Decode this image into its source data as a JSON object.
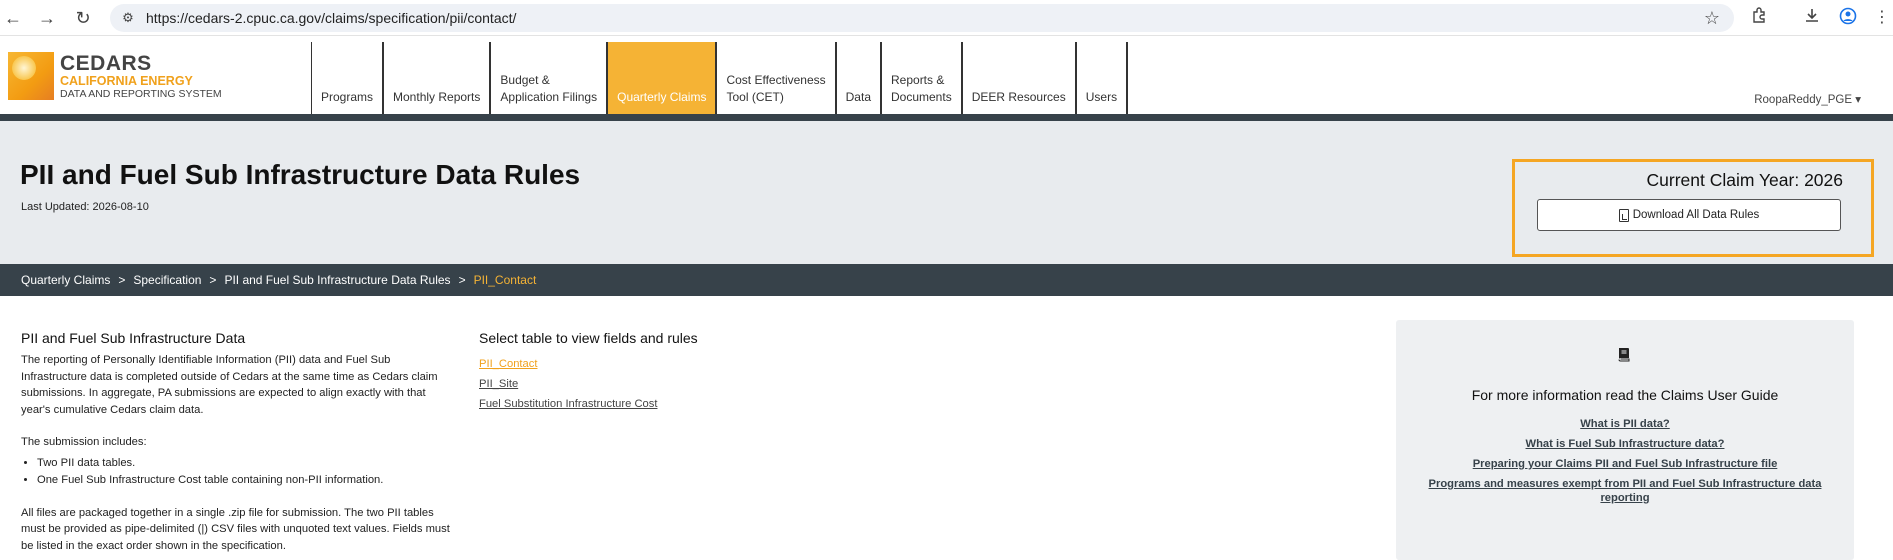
{
  "browser": {
    "url": "https://cedars-2.cpuc.ca.gov/claims/specification/pii/contact/",
    "back_icon": "←",
    "forward_icon": "→",
    "reload_icon": "↻",
    "star_icon": "☆",
    "menu_icon": "⋮"
  },
  "logo": {
    "name": "CEDARS",
    "line1": "CALIFORNIA ENERGY",
    "line2": "DATA AND REPORTING SYSTEM"
  },
  "nav": {
    "items": [
      {
        "label": "Programs"
      },
      {
        "label": "Monthly Reports"
      },
      {
        "label": "Budget &\nApplication Filings"
      },
      {
        "label": "Quarterly Claims"
      },
      {
        "label": "Cost Effectiveness\nTool (CET)"
      },
      {
        "label": "Data"
      },
      {
        "label": "Reports &\nDocuments"
      },
      {
        "label": "DEER Resources"
      },
      {
        "label": "Users"
      }
    ],
    "user": "RoopaReddy_PGE ▾"
  },
  "hero": {
    "title": "PII and Fuel Sub Infrastructure Data Rules",
    "last_updated": "Last Updated: 2026-08-10",
    "claim_year": "Current Claim Year: 2026",
    "download_label": "Download All Data Rules"
  },
  "breadcrumb": {
    "items": [
      "Quarterly Claims",
      "Specification",
      "PII and Fuel Sub Infrastructure Data Rules"
    ],
    "separator": ">",
    "current": "PII_Contact"
  },
  "intro": {
    "heading": "PII and Fuel Sub Infrastructure Data",
    "para1": "The reporting of Personally Identifiable Information (PII) data and Fuel Sub Infrastructure data is completed outside of Cedars at the same time as Cedars claim submissions. In aggregate, PA submissions are expected to align exactly with that year's cumulative Cedars claim data.",
    "para2": "The submission includes:",
    "bullets": [
      "Two PII data tables.",
      "One Fuel Sub Infrastructure Cost table containing non-PII information."
    ],
    "para3": "All files are packaged together in a single .zip file for submission. The two PII tables must be provided as pipe-delimited (|) CSV files with unquoted text values. Fields must be listed in the exact order shown in the specification."
  },
  "tables": {
    "heading": "Select table to view fields and rules",
    "links": [
      "PII_Contact",
      "PII_Site",
      "Fuel Substitution Infrastructure Cost"
    ]
  },
  "guide": {
    "title": "For more information read the Claims User Guide",
    "links": [
      "What is PII data?",
      "What is Fuel Sub Infrastructure data?",
      "Preparing your Claims PII and Fuel Sub Infrastructure file",
      "Programs and measures exempt from PII and Fuel Sub Infrastructure data reporting"
    ]
  }
}
